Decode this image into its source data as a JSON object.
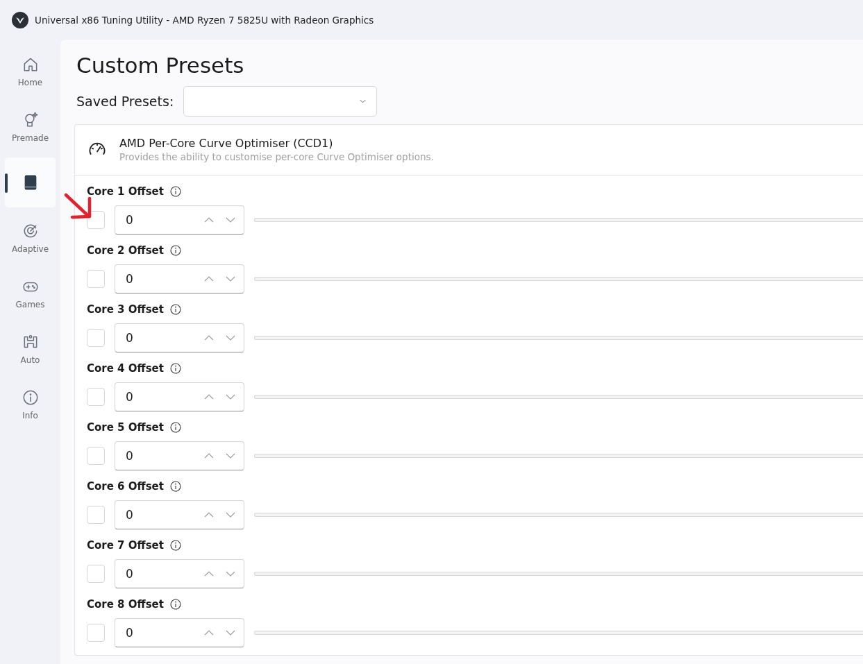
{
  "window": {
    "title": "Universal x86 Tuning Utility - AMD Ryzen 7 5825U with Radeon Graphics"
  },
  "sidebar": {
    "items": [
      {
        "label": "Home",
        "selected": false
      },
      {
        "label": "Premade",
        "selected": false
      },
      {
        "selected": true
      },
      {
        "label": "Adaptive",
        "selected": false
      },
      {
        "label": "Games",
        "selected": false
      },
      {
        "label": "Auto",
        "selected": false
      },
      {
        "label": "Info",
        "selected": false
      }
    ]
  },
  "page": {
    "title": "Custom Presets",
    "saved_presets_label": "Saved Presets:"
  },
  "section": {
    "title": "AMD Per-Core Curve Optimiser (CCD1)",
    "description": "Provides the ability to customise per-core Curve Optimiser options.",
    "rows": [
      {
        "label": "Core 1 Offset",
        "checked": false,
        "value": "0"
      },
      {
        "label": "Core 2 Offset",
        "checked": false,
        "value": "0"
      },
      {
        "label": "Core 3 Offset",
        "checked": false,
        "value": "0"
      },
      {
        "label": "Core 4 Offset",
        "checked": false,
        "value": "0"
      },
      {
        "label": "Core 5 Offset",
        "checked": false,
        "value": "0"
      },
      {
        "label": "Core 6 Offset",
        "checked": false,
        "value": "0"
      },
      {
        "label": "Core 7 Offset",
        "checked": false,
        "value": "0"
      },
      {
        "label": "Core 8 Offset",
        "checked": false,
        "value": "0"
      }
    ]
  }
}
